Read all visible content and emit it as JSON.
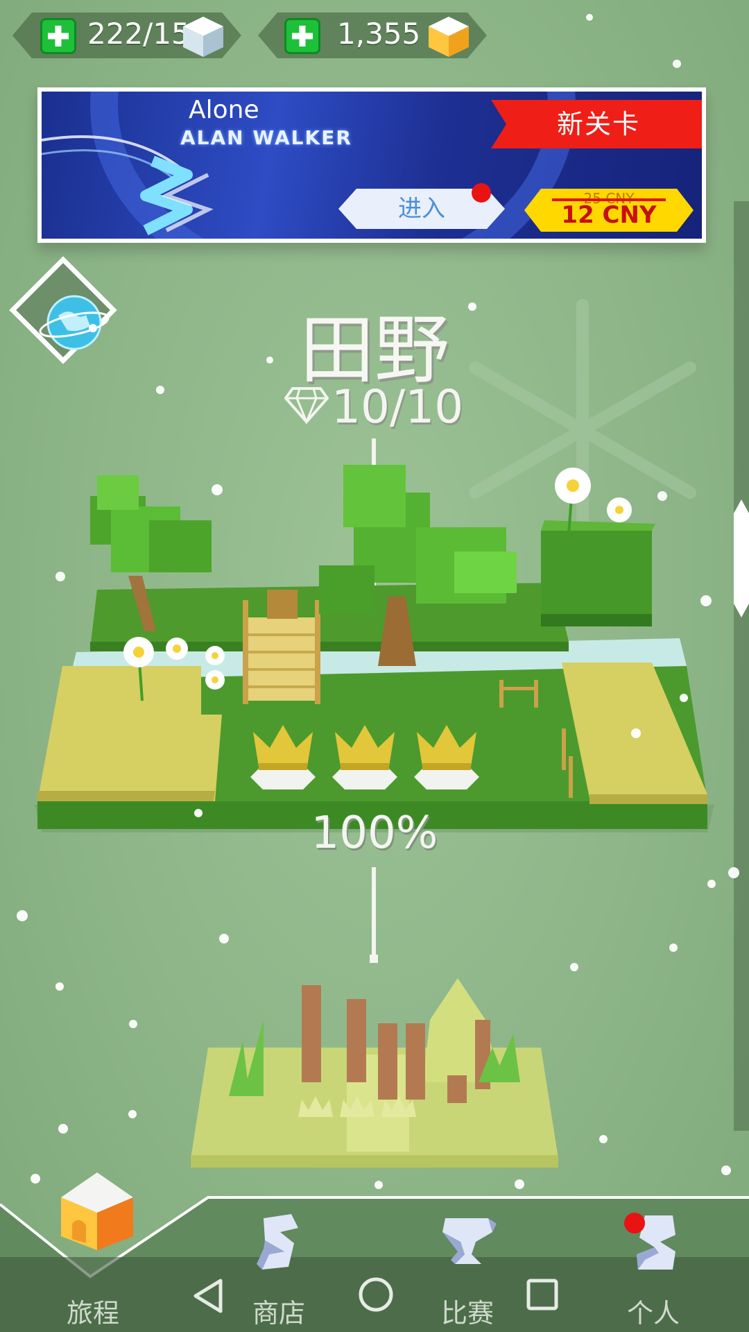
{
  "resources": {
    "lives": "222/15",
    "gems": "1,355"
  },
  "banner": {
    "song_title": "Alone",
    "artist": "ALAN WALKER",
    "ribbon": "新关卡",
    "enter_label": "进入",
    "old_price": "25 CNY",
    "new_price": "12 CNY"
  },
  "level": {
    "name": "田野",
    "gems_collected": "10/10",
    "progress": "100%",
    "progress_value": 1.0,
    "crowns_earned": 3
  },
  "nav": {
    "items": [
      {
        "label": "旅程"
      },
      {
        "label": "商店"
      },
      {
        "label": "比赛"
      },
      {
        "label": "个人"
      }
    ]
  },
  "colors": {
    "background": "#8db588",
    "accent_green": "#1ec03a",
    "ribbon_red": "#ef1e16",
    "price_yellow": "#ffd800",
    "notification_red": "#ea1313"
  }
}
